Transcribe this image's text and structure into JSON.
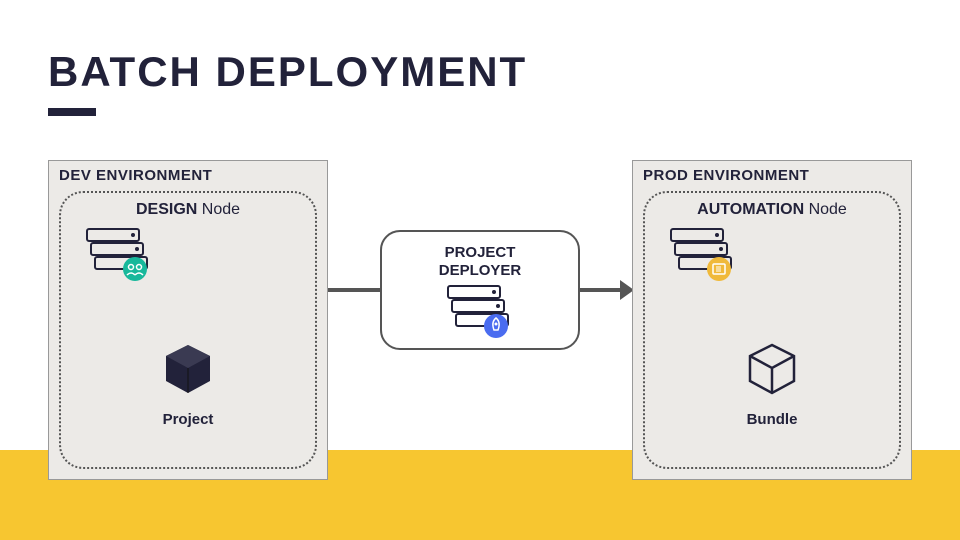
{
  "title": "BATCH DEPLOYMENT",
  "dev": {
    "env_label": "DEV ENVIRONMENT",
    "node_prefix": "DESIGN",
    "node_suffix": " Node",
    "item_label": "Project"
  },
  "prod": {
    "env_label": "PROD ENVIRONMENT",
    "node_prefix": "AUTOMATION",
    "node_suffix": " Node",
    "item_label": "Bundle"
  },
  "deployer": {
    "line1": "PROJECT",
    "line2": "DEPLOYER"
  },
  "colors": {
    "dark": "#22223a",
    "teal": "#18b89b",
    "blue": "#4a6cf0",
    "gold": "#f0b93a"
  }
}
